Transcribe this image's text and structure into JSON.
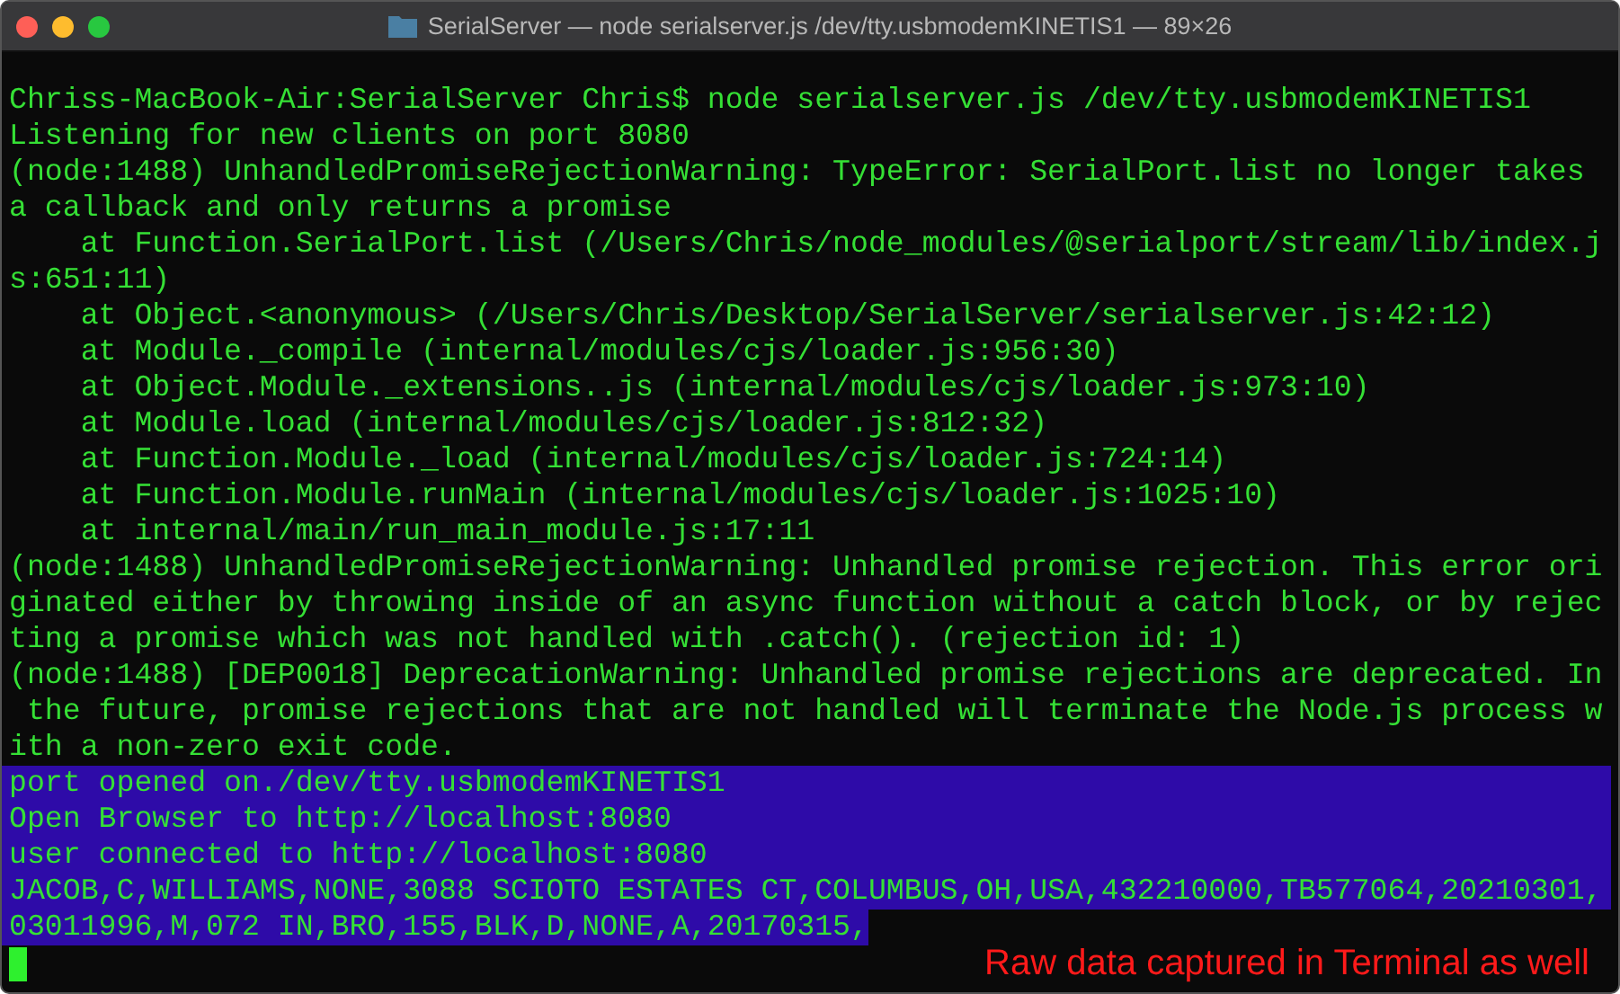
{
  "window": {
    "title": "SerialServer — node serialserver.js /dev/tty.usbmodemKINETIS1 — 89×26"
  },
  "terminal": {
    "lines": [
      {
        "text": "Chriss-MacBook-Air:SerialServer Chris$ node serialserver.js /dev/tty.usbmodemKINETIS1",
        "selected": false
      },
      {
        "text": "Listening for new clients on port 8080",
        "selected": false
      },
      {
        "text": "(node:1488) UnhandledPromiseRejectionWarning: TypeError: SerialPort.list no longer takes",
        "selected": false
      },
      {
        "text": "a callback and only returns a promise",
        "selected": false
      },
      {
        "text": "    at Function.SerialPort.list (/Users/Chris/node_modules/@serialport/stream/lib/index.j",
        "selected": false
      },
      {
        "text": "s:651:11)",
        "selected": false
      },
      {
        "text": "    at Object.<anonymous> (/Users/Chris/Desktop/SerialServer/serialserver.js:42:12)",
        "selected": false
      },
      {
        "text": "    at Module._compile (internal/modules/cjs/loader.js:956:30)",
        "selected": false
      },
      {
        "text": "    at Object.Module._extensions..js (internal/modules/cjs/loader.js:973:10)",
        "selected": false
      },
      {
        "text": "    at Module.load (internal/modules/cjs/loader.js:812:32)",
        "selected": false
      },
      {
        "text": "    at Function.Module._load (internal/modules/cjs/loader.js:724:14)",
        "selected": false
      },
      {
        "text": "    at Function.Module.runMain (internal/modules/cjs/loader.js:1025:10)",
        "selected": false
      },
      {
        "text": "    at internal/main/run_main_module.js:17:11",
        "selected": false
      },
      {
        "text": "(node:1488) UnhandledPromiseRejectionWarning: Unhandled promise rejection. This error ori",
        "selected": false
      },
      {
        "text": "ginated either by throwing inside of an async function without a catch block, or by rejec",
        "selected": false
      },
      {
        "text": "ting a promise which was not handled with .catch(). (rejection id: 1)",
        "selected": false
      },
      {
        "text": "(node:1488) [DEP0018] DeprecationWarning: Unhandled promise rejections are deprecated. In",
        "selected": false
      },
      {
        "text": " the future, promise rejections that are not handled will terminate the Node.js process w",
        "selected": false
      },
      {
        "text": "ith a non-zero exit code.",
        "selected": false
      },
      {
        "text": "port opened on./dev/tty.usbmodemKINETIS1",
        "selected": true,
        "full_row": true
      },
      {
        "text": "Open Browser to http://localhost:8080",
        "selected": true,
        "full_row": true
      },
      {
        "text": "user connected to http://localhost:8080",
        "selected": true,
        "full_row": true
      },
      {
        "text": "JACOB,C,WILLIAMS,NONE,3088 SCIOTO ESTATES CT,COLUMBUS,OH,USA,432210000,TB577064,20210301,",
        "selected": true,
        "full_row": true
      },
      {
        "text": "03011996,M,072 IN,BRO,155,BLK,D,NONE,A,20170315,",
        "selected": true,
        "full_row": false
      }
    ],
    "annotation": "Raw data captured in Terminal as well"
  }
}
